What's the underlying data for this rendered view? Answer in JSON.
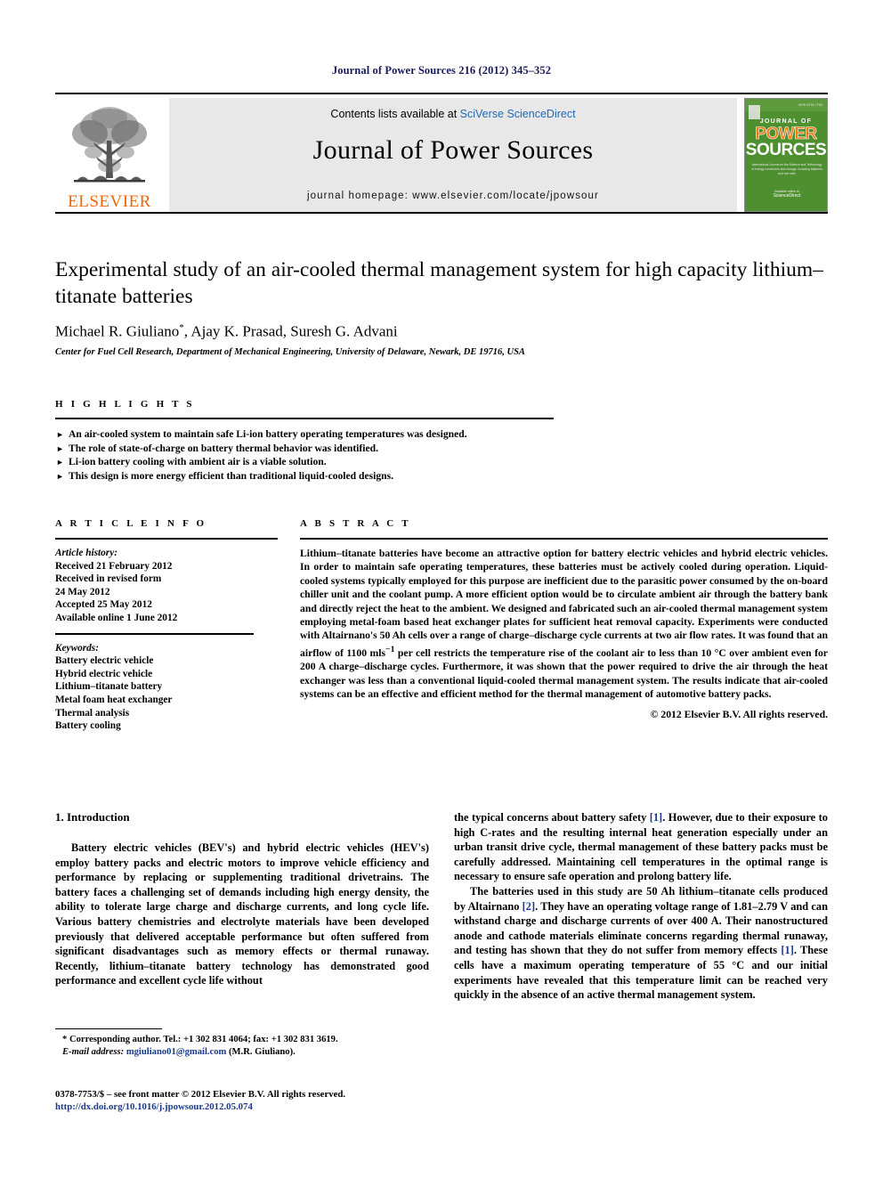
{
  "running_head": "Journal of Power Sources 216 (2012) 345–352",
  "masthead": {
    "publisher_name": "ELSEVIER",
    "contents_prefix": "Contents lists available at ",
    "contents_link": "SciVerse ScienceDirect",
    "journal_title": "Journal of Power Sources",
    "homepage": "journal homepage: www.elsevier.com/locate/jpowsour",
    "cover": {
      "issn": "ISSN 0378-7753",
      "line1": "JOURNAL OF",
      "line2": "POWER",
      "line3": "SOURCES",
      "subtitle": "International Journal on the Science and Technology of energy conversion and storage, including batteries and fuel cells",
      "footer_small": "Available online at",
      "footer_big": "ScienceDirect"
    }
  },
  "article": {
    "title": "Experimental study of an air-cooled thermal management system for high capacity lithium–titanate batteries",
    "authors": "Michael R. Giuliano",
    "authors_star": "*",
    "authors_rest": ", Ajay K. Prasad, Suresh G. Advani",
    "affiliation": "Center for Fuel Cell Research, Department of Mechanical Engineering, University of Delaware, Newark, DE 19716, USA"
  },
  "highlights": {
    "heading": "H I G H L I G H T S",
    "items": [
      "An air-cooled system to maintain safe Li-ion battery operating temperatures was designed.",
      "The role of state-of-charge on battery thermal behavior was identified.",
      "Li-ion battery cooling with ambient air is a viable solution.",
      "This design is more energy efficient than traditional liquid-cooled designs."
    ],
    "bullet_glyph": "►"
  },
  "article_info": {
    "heading": "A R T I C L E   I N F O",
    "history_label": "Article history:",
    "history": [
      "Received 21 February 2012",
      "Received in revised form",
      "24 May 2012",
      "Accepted 25 May 2012",
      "Available online 1 June 2012"
    ],
    "keywords_label": "Keywords:",
    "keywords": [
      "Battery electric vehicle",
      "Hybrid electric vehicle",
      "Lithium–titanate battery",
      "Metal foam heat exchanger",
      "Thermal analysis",
      "Battery cooling"
    ]
  },
  "abstract": {
    "heading": "A B S T R A C T",
    "text_part1": "Lithium–titanate batteries have become an attractive option for battery electric vehicles and hybrid electric vehicles. In order to maintain safe operating temperatures, these batteries must be actively cooled during operation. Liquid-cooled systems typically employed for this purpose are inefficient due to the parasitic power consumed by the on-board chiller unit and the coolant pump. A more efficient option would be to circulate ambient air through the battery bank and directly reject the heat to the ambient. We designed and fabricated such an air-cooled thermal management system employing metal-foam based heat exchanger plates for sufficient heat removal capacity. Experiments were conducted with Altairnano's 50 Ah cells over a range of charge–discharge cycle currents at two air flow rates. It was found that an airflow of 1100 mls",
    "superscript": "−1",
    "text_part2": " per cell restricts the temperature rise of the coolant air to less than 10 °C over ambient even for 200 A charge–discharge cycles. Furthermore, it was shown that the power required to drive the air through the heat exchanger was less than a conventional liquid-cooled thermal management system. The results indicate that air-cooled systems can be an effective and efficient method for the thermal management of automotive battery packs.",
    "rights": "© 2012 Elsevier B.V. All rights reserved."
  },
  "body": {
    "section_heading": "1. Introduction",
    "left_paragraph": "Battery electric vehicles (BEV's) and hybrid electric vehicles (HEV's) employ battery packs and electric motors to improve vehicle efficiency and performance by replacing or supplementing traditional drivetrains. The battery faces a challenging set of demands including high energy density, the ability to tolerate large charge and discharge currents, and long cycle life. Various battery chemistries and electrolyte materials have been developed previously that delivered acceptable performance but often suffered from significant disadvantages such as memory effects or thermal runaway. Recently, lithium–titanate battery technology has demonstrated good performance and excellent cycle life without",
    "right_paragraph_1_a": "the typical concerns about battery safety ",
    "right_paragraph_1_ref": "[1]",
    "right_paragraph_1_b": ". However, due to their exposure to high C-rates and the resulting internal heat generation especially under an urban transit drive cycle, thermal management of these battery packs must be carefully addressed. Maintaining cell temperatures in the optimal range is necessary to ensure safe operation and prolong battery life.",
    "right_paragraph_2_a": "The batteries used in this study are 50 Ah lithium–titanate cells produced by Altairnano ",
    "right_paragraph_2_ref1": "[2]",
    "right_paragraph_2_b": ". They have an operating voltage range of 1.81–2.79 V and can withstand charge and discharge currents of over 400 A. Their nanostructured anode and cathode materials eliminate concerns regarding thermal runaway, and testing has shown that they do not suffer from memory effects ",
    "right_paragraph_2_ref2": "[1]",
    "right_paragraph_2_c": ". These cells have a maximum operating temperature of 55 °C and our initial experiments have revealed that this temperature limit can be reached very quickly in the absence of an active thermal management system."
  },
  "footnotes": {
    "corresponding": "* Corresponding author. Tel.: +1 302 831 4064; fax: +1 302 831 3619.",
    "email_label": "E-mail address:",
    "email": "mgiuliano01@gmail.com",
    "email_suffix": "(M.R. Giuliano)."
  },
  "imprint": {
    "line": "0378-7753/$ – see front matter © 2012 Elsevier B.V. All rights reserved.",
    "doi": "http://dx.doi.org/10.1016/j.jpowsour.2012.05.074"
  },
  "colors": {
    "link_blue": "#1a3a8f",
    "sciencedirect_blue": "#2469b2",
    "elsevier_orange": "#ec6707",
    "cover_green": "#4e9030",
    "cover_orange": "#f07a18"
  }
}
